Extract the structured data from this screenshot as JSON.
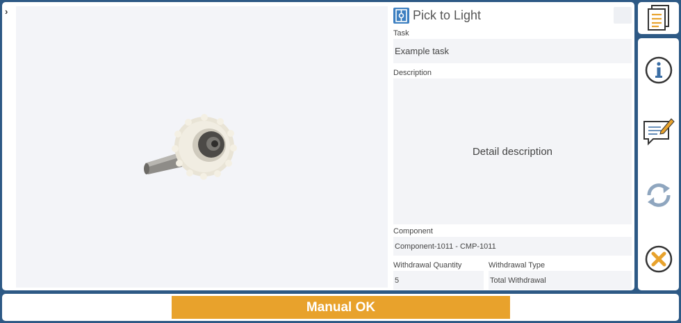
{
  "header": {
    "title": "Pick to Light"
  },
  "fields": {
    "task": {
      "label": "Task",
      "value": "Example task"
    },
    "description": {
      "label": "Description",
      "value": "Detail description"
    },
    "component": {
      "label": "Component",
      "value": "Component-1011 - CMP-1011"
    },
    "withdrawal_quantity": {
      "label": "Withdrawal Quantity",
      "value": "5"
    },
    "withdrawal_type": {
      "label": "Withdrawal Type",
      "value": "Total Withdrawal"
    }
  },
  "bottom": {
    "ok_label": "Manual OK"
  },
  "sidebar": {
    "items": [
      {
        "icon": "document-icon"
      },
      {
        "icon": "info-icon"
      },
      {
        "icon": "comment-edit-icon"
      },
      {
        "icon": "refresh-icon"
      },
      {
        "icon": "cancel-icon"
      }
    ]
  },
  "colors": {
    "accent": "#e8a22c",
    "frame": "#2d5985",
    "brand": "#3d7fc1"
  }
}
